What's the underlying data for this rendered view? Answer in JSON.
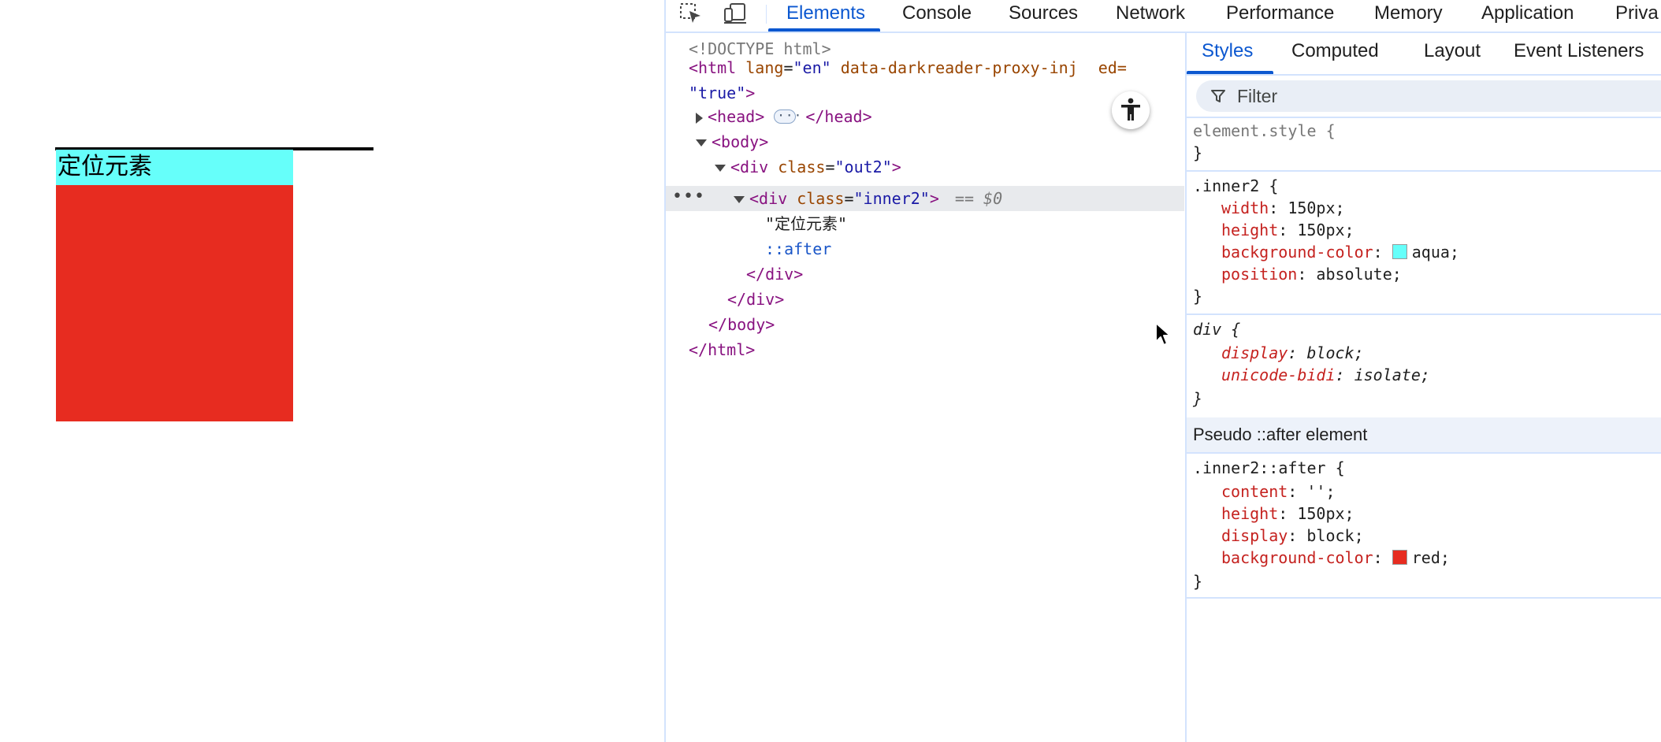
{
  "viewport": {
    "inner2_text": "定位元素",
    "colors": {
      "inner2_bg": "#66fffa",
      "after_bg": "#e72c20",
      "out2_border": "#000000"
    }
  },
  "devtools": {
    "toolbar_icons": [
      "inspect-element-icon",
      "device-toolbar-icon"
    ],
    "tabs": [
      "Elements",
      "Console",
      "Sources",
      "Network",
      "Performance",
      "Memory",
      "Application",
      "Priva"
    ],
    "active_tab": "Elements",
    "dom": {
      "doctype": "<!DOCTYPE html>",
      "html_open_1": "<html",
      "html_attr1_name": "lang",
      "html_attr1_val": "\"en\"",
      "html_attr2_name": "data-darkreader-proxy-inj",
      "html_attr2_tail": "ed=",
      "html_open_2_val": "\"true\"",
      "head_open": "<head>",
      "head_close": "</head>",
      "body_open": "<body>",
      "div_open": "<div",
      "class_attr": "class",
      "out2_val": "\"out2\"",
      "inner2_val": "\"inner2\"",
      "gt": ">",
      "eq_s0": "== $0",
      "text_node": "\"定位元素\"",
      "after_pseudo": "::after",
      "div_close": "</div>",
      "body_close": "</body>",
      "html_close": "</html>",
      "sel_dots": "•••"
    },
    "styles": {
      "tabs": [
        "Styles",
        "Computed",
        "Layout",
        "Event Listeners"
      ],
      "active_tab": "Styles",
      "filter_placeholder": "Filter",
      "element_style_selector": "element.style {",
      "close_brace": "}",
      "inner2_rule": {
        "selector": ".inner2 {",
        "props": [
          {
            "name": "width",
            "value": "150px;"
          },
          {
            "name": "height",
            "value": "150px;"
          },
          {
            "name": "background-color",
            "value": "aqua;",
            "swatch": "#66fffa"
          },
          {
            "name": "position",
            "value": "absolute;"
          }
        ]
      },
      "div_rule": {
        "selector": "div {",
        "props": [
          {
            "name": "display",
            "value": "block;"
          },
          {
            "name": "unicode-bidi",
            "value": "isolate;"
          }
        ]
      },
      "pseudo_header": "Pseudo ::after element",
      "after_rule": {
        "selector": ".inner2::after {",
        "props": [
          {
            "name": "content",
            "value": "'';"
          },
          {
            "name": "height",
            "value": "150px;"
          },
          {
            "name": "display",
            "value": "block;"
          },
          {
            "name": "background-color",
            "value": "red;",
            "swatch": "#e72c20"
          }
        ]
      }
    }
  }
}
